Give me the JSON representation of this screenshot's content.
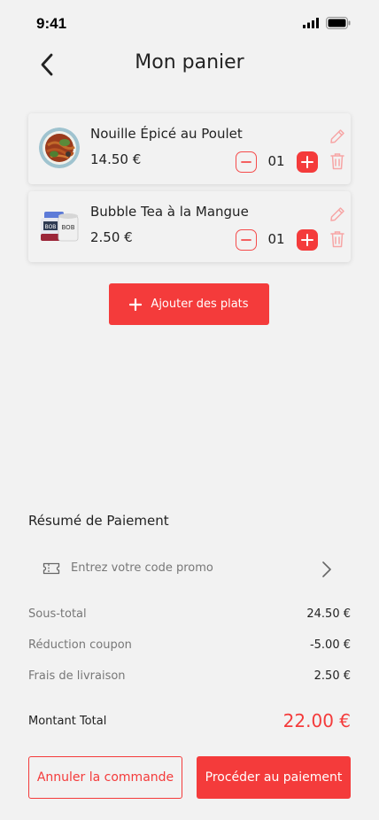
{
  "status_bar": {
    "time": "9:41"
  },
  "header": {
    "title": "Mon panier",
    "back_icon": "chevron-left-icon"
  },
  "cart": {
    "items": [
      {
        "name": "Nouille Épicé au Poulet",
        "price": "14.50 €",
        "quantity": "01"
      },
      {
        "name": "Bubble Tea à la Mangue",
        "price": "2.50 €",
        "quantity": "01"
      }
    ]
  },
  "add_button": {
    "label": "Ajouter des plats",
    "icon": "plus-icon"
  },
  "summary": {
    "title": "Résumé de Paiement",
    "promo_placeholder": "Entrez votre code promo",
    "rows": [
      {
        "label": "Sous-total",
        "value": "24.50 €"
      },
      {
        "label": "Réduction coupon",
        "value": "-5.00 €"
      },
      {
        "label": "Frais de livraison",
        "value": "2.50 €"
      }
    ],
    "total_label": "Montant Total",
    "total_value": "22.00 €"
  },
  "actions": {
    "cancel_label": "Annuler la commande",
    "pay_label": "Procéder au paiement"
  },
  "colors": {
    "accent": "#f43b3b",
    "background": "#f2f2f2",
    "muted_text": "#777777"
  }
}
